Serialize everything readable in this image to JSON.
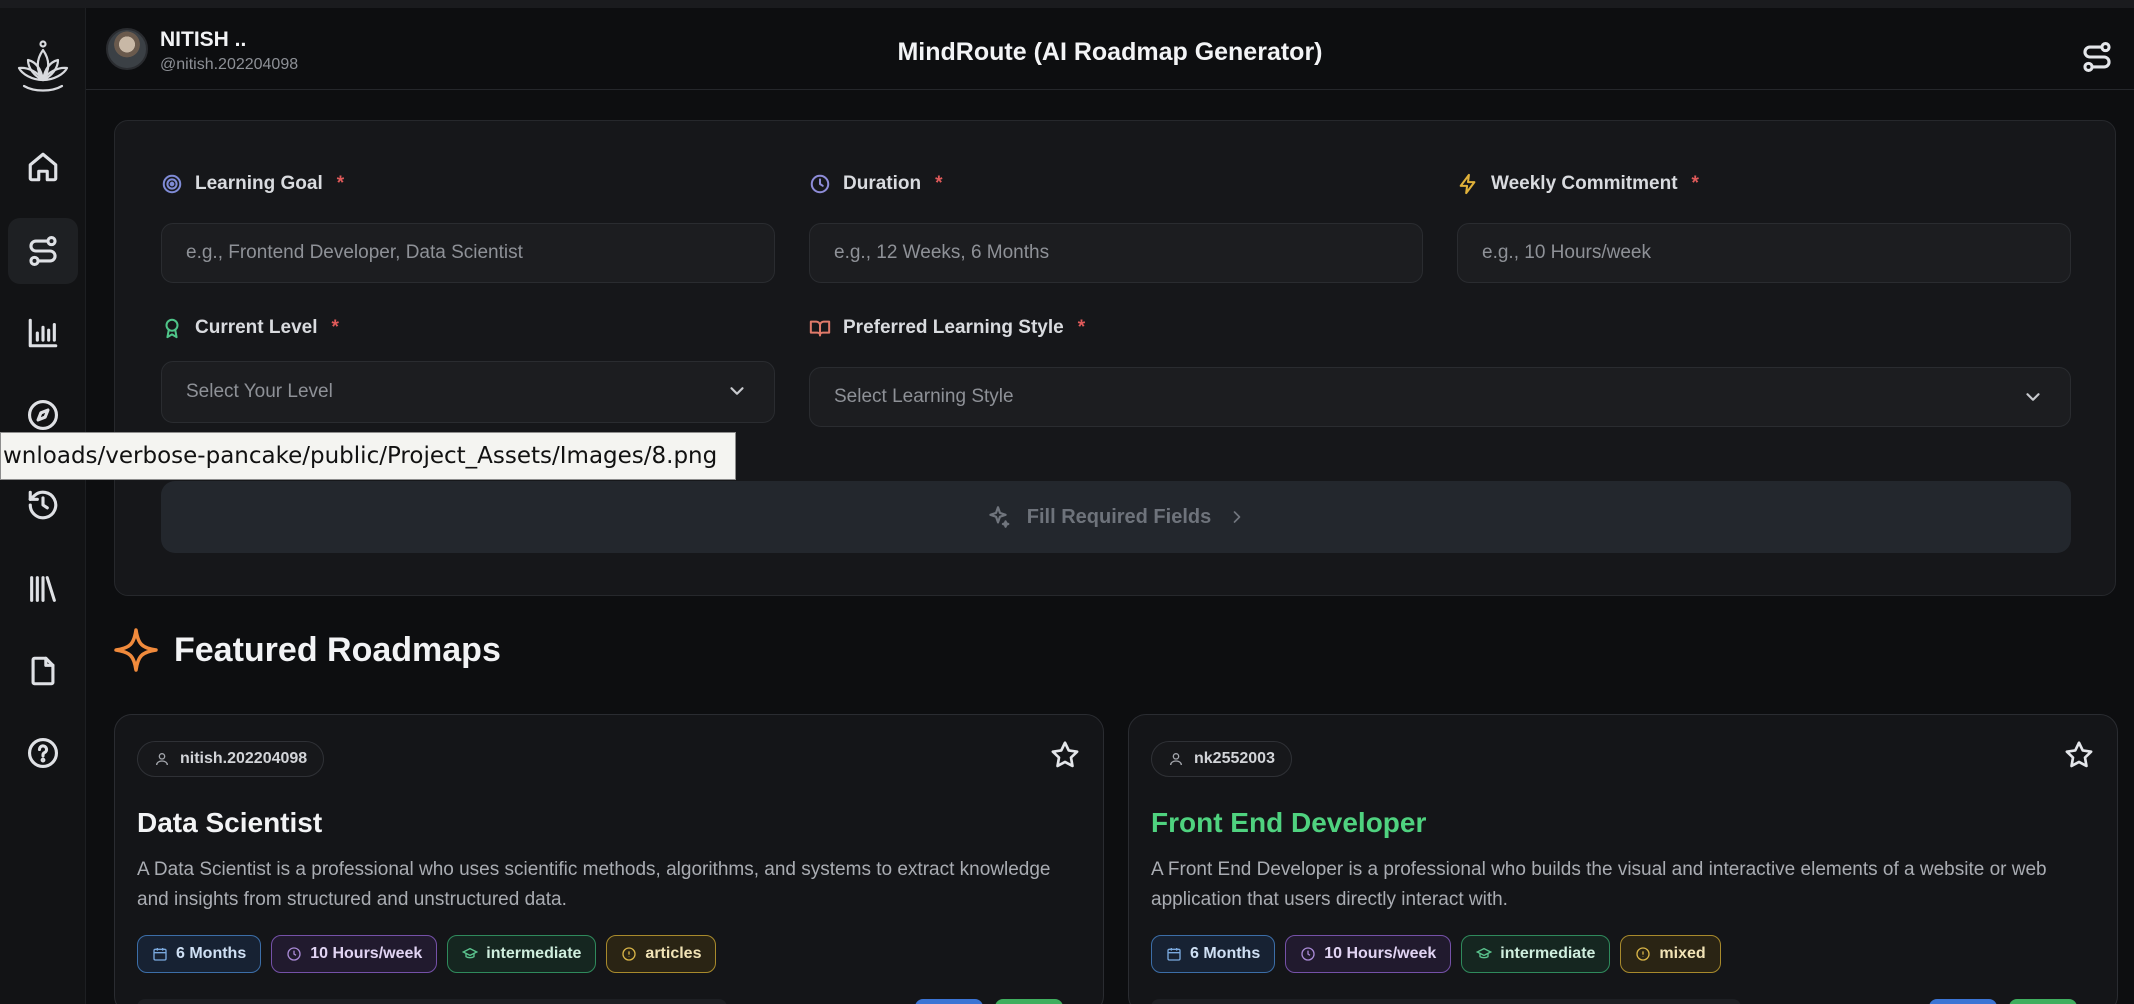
{
  "header": {
    "user_name": "NITISH ..",
    "user_handle": "@nitish.202204098",
    "app_title": "MindRoute (AI Roadmap Generator)"
  },
  "sidebar": {
    "items": [
      {
        "icon": "home-icon"
      },
      {
        "icon": "route-icon",
        "active": true
      },
      {
        "icon": "bar-chart-icon"
      },
      {
        "icon": "compass-icon"
      },
      {
        "icon": "history-icon"
      },
      {
        "icon": "library-icon"
      },
      {
        "icon": "file-icon"
      },
      {
        "icon": "help-icon"
      }
    ]
  },
  "form": {
    "learning_goal": {
      "label": "Learning Goal",
      "required": "*",
      "placeholder": "e.g., Frontend Developer, Data Scientist"
    },
    "duration": {
      "label": "Duration",
      "required": "*",
      "placeholder": "e.g., 12 Weeks, 6 Months"
    },
    "weekly_commitment": {
      "label": "Weekly Commitment",
      "required": "*",
      "placeholder": "e.g., 10 Hours/week"
    },
    "current_level": {
      "label": "Current Level",
      "required": "*",
      "value": "Select Your Level"
    },
    "learning_style": {
      "label": "Preferred Learning Style",
      "required": "*",
      "value": "Select Learning Style"
    },
    "submit_label": "Fill Required Fields"
  },
  "tooltip": "wnloads/verbose-pancake/public/Project_Assets/Images/8.png",
  "featured": {
    "title": "Featured Roadmaps",
    "cards": [
      {
        "author": "nitish.202204098",
        "title": "Data Scientist",
        "title_color": "#f2f3f5",
        "description": "A Data Scientist is a professional who uses scientific methods, algorithms, and systems to extract knowledge and insights from structured and unstructured data.",
        "tags": {
          "duration": "6 Months",
          "hours": "10 Hours/week",
          "level": "intermediate",
          "style": "articles"
        }
      },
      {
        "author": "nk2552003",
        "title": "Front End Developer",
        "title_color": "#4fd27f",
        "description": "A Front End Developer is a professional who builds the visual and interactive elements of a website or web application that users directly interact with.",
        "tags": {
          "duration": "6 Months",
          "hours": "10 Hours/week",
          "level": "intermediate",
          "style": "mixed"
        }
      }
    ]
  },
  "colors": {
    "accent_orange": "#f08a3c",
    "required_red": "#e05a5a",
    "primary_blue": "#3b74d4",
    "success_green": "#3fae5e"
  }
}
